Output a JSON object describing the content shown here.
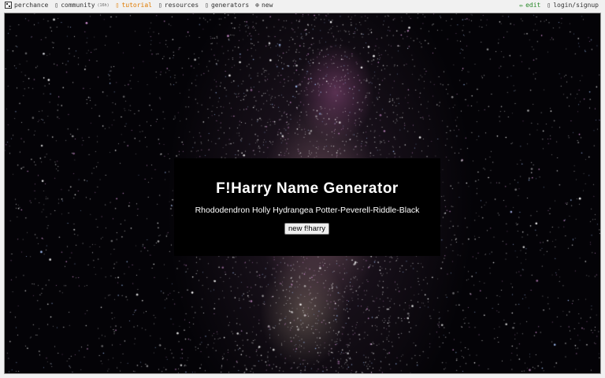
{
  "nav": {
    "left": [
      {
        "label": "perchance",
        "icon": "perchance-logo-icon",
        "color": "#333333"
      },
      {
        "label": "community",
        "badge": "(16h)",
        "icon": "chat-icon",
        "color": "#333333"
      },
      {
        "label": "tutorial",
        "icon": "book-icon",
        "color": "#e07b00"
      },
      {
        "label": "resources",
        "icon": "resources-icon",
        "color": "#333333"
      },
      {
        "label": "generators",
        "icon": "generators-icon",
        "color": "#333333"
      },
      {
        "label": "new",
        "icon": "plus-circle-icon",
        "color": "#333333"
      }
    ],
    "right": [
      {
        "label": "edit",
        "icon": "pencil-icon",
        "color": "#2a8a2a"
      },
      {
        "label": "login/signup",
        "icon": "user-icon",
        "color": "#333333"
      }
    ]
  },
  "generator": {
    "title": "F!Harry Name Generator",
    "result": "Rhododendron Holly Hydrangea Potter-Peverell-Riddle-Black",
    "button_label": "new f!harry"
  },
  "colors": {
    "background": "#040307",
    "card": "#000000",
    "text": "#ffffff",
    "accent_tutorial": "#e07b00",
    "accent_edit": "#2a8a2a"
  }
}
